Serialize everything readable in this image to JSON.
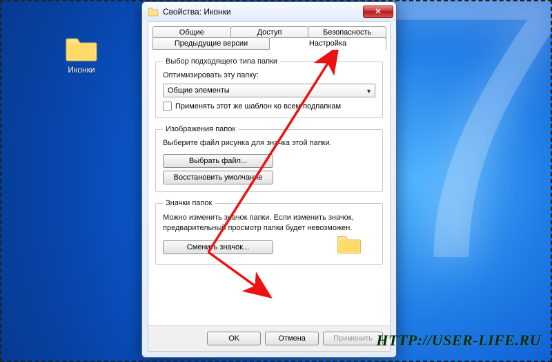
{
  "desktop": {
    "icon_label": "Иконки"
  },
  "dialog": {
    "title": "Свойства: Иконки",
    "tabs": {
      "general": "Общие",
      "sharing": "Доступ",
      "security": "Безопасность",
      "previous_versions": "Предыдущие версии",
      "customize": "Настройка"
    },
    "folder_type": {
      "legend": "Выбор подходящего типа папки",
      "optimize_label": "Оптимизировать эту папку:",
      "combo_value": "Общие элементы",
      "apply_template_label": "Применять этот же шаблон ко всем подпапкам"
    },
    "folder_pictures": {
      "legend": "Изображения папок",
      "help": "Выберите файл рисунка для значка этой папки.",
      "choose_file": "Выбрать файл...",
      "restore_default": "Восстановить умолчание"
    },
    "folder_icons": {
      "legend": "Значки папок",
      "help": "Можно изменить значок папки. Если изменить значок, предварительный просмотр папки будет невозможен.",
      "change_icon": "Сменить значок..."
    },
    "buttons": {
      "ok": "OK",
      "cancel": "Отмена",
      "apply": "Применить"
    }
  },
  "watermark": "HTTP://USER-LIFE.RU"
}
